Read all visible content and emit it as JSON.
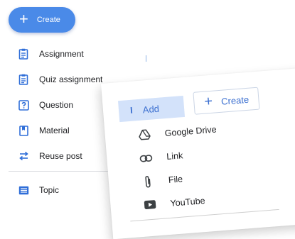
{
  "create_button": {
    "label": "Create",
    "color": "#4a8ae8"
  },
  "menu": {
    "items": [
      {
        "label": "Assignment",
        "icon": "assignment-icon"
      },
      {
        "label": "Quiz assignment",
        "icon": "quiz-assignment-icon"
      },
      {
        "label": "Question",
        "icon": "question-icon"
      },
      {
        "label": "Material",
        "icon": "material-icon"
      },
      {
        "label": "Reuse post",
        "icon": "reuse-post-icon"
      }
    ],
    "topic": {
      "label": "Topic",
      "icon": "topic-icon"
    }
  },
  "panel": {
    "add_label": "Add",
    "create_label": "Create",
    "dropdown": [
      {
        "label": "Google Drive",
        "icon": "google-drive-icon"
      },
      {
        "label": "Link",
        "icon": "link-icon"
      },
      {
        "label": "File",
        "icon": "file-attachment-icon"
      },
      {
        "label": "YouTube",
        "icon": "youtube-icon"
      }
    ]
  },
  "colors": {
    "accent": "#4a8ae8",
    "icon_blue": "#2f6ed8",
    "add_bg": "#d3e2fa"
  }
}
